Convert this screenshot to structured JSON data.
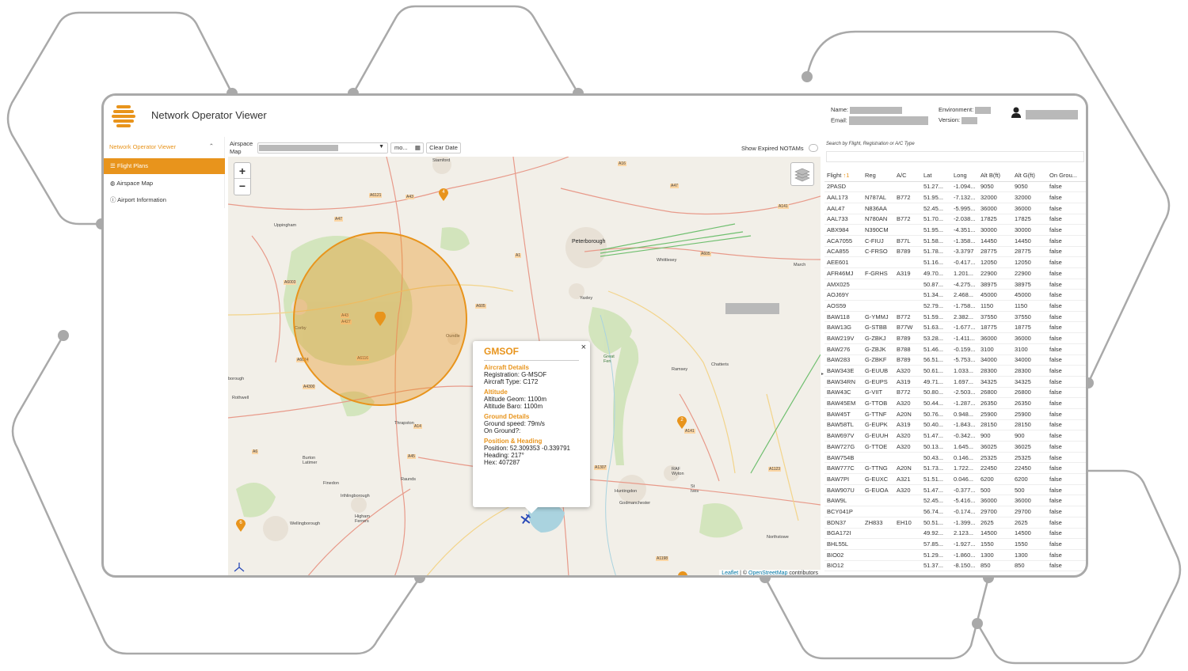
{
  "app": {
    "title": "Network Operator Viewer"
  },
  "header": {
    "name_label": "Name:",
    "email_label": "Email:",
    "environment_label": "Environment:",
    "version_label": "Version:"
  },
  "sidebar": {
    "section": "Network Operator Viewer",
    "items": [
      {
        "label": "Flight Plans",
        "icon": "list-icon"
      },
      {
        "label": "Airspace Map",
        "icon": "globe-icon"
      },
      {
        "label": "Airport Information",
        "icon": "info-icon"
      }
    ]
  },
  "toolbar": {
    "airspace_label_1": "Airspace",
    "airspace_label_2": "Map",
    "date_value": "mo...",
    "clear_date": "Clear Date",
    "show_expired": "Show Expired NOTAMs"
  },
  "map": {
    "zoom_in": "+",
    "zoom_out": "−",
    "attribution_leaflet": "Leaflet",
    "attribution_sep": "| ©",
    "attribution_osm": "OpenStreetMap",
    "attribution_tail": "contributors",
    "places": [
      "Stamford",
      "Uppingham",
      "Peterborough",
      "Whittlesey",
      "March",
      "Yaxley",
      "Corby",
      "Oundle",
      "Ramsey",
      "Chatteris",
      "Great Fen",
      "Thrapston",
      "Burton Latimer",
      "Raunds",
      "Finedon",
      "Irthlingborough",
      "Higham Ferrers",
      "Wellingborough",
      "Huntingdon",
      "Godmanchester",
      "St Ives",
      "RAF Wyton",
      "Northstowe",
      "Rothwell",
      "borough"
    ],
    "roads": [
      "A16",
      "A47",
      "A43",
      "A6121",
      "A47",
      "A141",
      "A1",
      "A605",
      "A6003",
      "A43",
      "A427",
      "A6116",
      "A6014",
      "A4300",
      "A605",
      "A14",
      "A45",
      "A1307",
      "A141",
      "A1123",
      "A1198",
      "A6"
    ],
    "markers": [
      "2",
      "2",
      "6",
      "4"
    ]
  },
  "popup": {
    "title": "GMSOF",
    "close": "×",
    "aircraft_header": "Aircraft Details",
    "registration": "Registration: G-MSOF",
    "aircraft_type": "Aircraft Type: C172",
    "altitude_header": "Altitude",
    "alt_geom": "Altitude Geom: 1100m",
    "alt_baro": "Altitude Baro: 1100m",
    "ground_header": "Ground Details",
    "ground_speed": "Ground speed: 79m/s",
    "on_ground": "On Ground?:",
    "position_header": "Position & Heading",
    "position": "Position: 52.309353 -0.339791",
    "heading": "Heading: 217°",
    "hex": "Hex: 407287"
  },
  "table": {
    "search_placeholder": "Search by Flight, Registration or A/C Type",
    "columns": [
      "Flight",
      "Reg",
      "A/C",
      "Lat",
      "Long",
      "Alt B(ft)",
      "Alt G(ft)",
      "On Grou..."
    ],
    "sort_indicator": "↑1",
    "rows": [
      [
        "2PASD",
        "",
        "",
        "51.27...",
        "-1.094...",
        "9050",
        "9050",
        "false"
      ],
      [
        "AAL173",
        "N787AL",
        "B772",
        "51.95...",
        "-7.132...",
        "32000",
        "32000",
        "false"
      ],
      [
        "AAL47",
        "N836AA",
        "",
        "52.45...",
        "-5.995...",
        "36000",
        "36000",
        "false"
      ],
      [
        "AAL733",
        "N780AN",
        "B772",
        "51.70...",
        "-2.038...",
        "17825",
        "17825",
        "false"
      ],
      [
        "ABX984",
        "N390CM",
        "",
        "51.95...",
        "-4.351...",
        "30000",
        "30000",
        "false"
      ],
      [
        "ACA7055",
        "C-FIUJ",
        "B77L",
        "51.58...",
        "-1.358...",
        "14450",
        "14450",
        "false"
      ],
      [
        "ACA855",
        "C-FRSO",
        "B789",
        "51.78...",
        "-3.3797",
        "28775",
        "28775",
        "false"
      ],
      [
        "AEE601",
        "",
        "",
        "51.16...",
        "-0.417...",
        "12050",
        "12050",
        "false"
      ],
      [
        "AFR46MJ",
        "F-GRHS",
        "A319",
        "49.70...",
        "1.201...",
        "22900",
        "22900",
        "false"
      ],
      [
        "AMX025",
        "",
        "",
        "50.87...",
        "-4.275...",
        "38975",
        "38975",
        "false"
      ],
      [
        "AOJ69Y",
        "",
        "",
        "51.34...",
        "2.468...",
        "45000",
        "45000",
        "false"
      ],
      [
        "AOS59",
        "",
        "",
        "52.79...",
        "-1.758...",
        "1150",
        "1150",
        "false"
      ],
      [
        "BAW118",
        "G-YMMJ",
        "B772",
        "51.59...",
        "2.382...",
        "37550",
        "37550",
        "false"
      ],
      [
        "BAW13G",
        "G-STBB",
        "B77W",
        "51.63...",
        "-1.677...",
        "18775",
        "18775",
        "false"
      ],
      [
        "BAW219V",
        "G-ZBKJ",
        "B789",
        "53.28...",
        "-1.411...",
        "36000",
        "36000",
        "false"
      ],
      [
        "BAW276",
        "G-ZBJK",
        "B788",
        "51.46...",
        "-0.159...",
        "3100",
        "3100",
        "false"
      ],
      [
        "BAW283",
        "G-ZBKF",
        "B789",
        "56.51...",
        "-5.753...",
        "34000",
        "34000",
        "false"
      ],
      [
        "BAW343E",
        "G-EUUB",
        "A320",
        "50.61...",
        "1.033...",
        "28300",
        "28300",
        "false"
      ],
      [
        "BAW34RN",
        "G-EUPS",
        "A319",
        "49.71...",
        "1.697...",
        "34325",
        "34325",
        "false"
      ],
      [
        "BAW43C",
        "G-VIIT",
        "B772",
        "50.80...",
        "-2.503...",
        "26800",
        "26800",
        "false"
      ],
      [
        "BAW45EM",
        "G-TTOB",
        "A320",
        "50.44...",
        "-1.287...",
        "26350",
        "26350",
        "false"
      ],
      [
        "BAW45T",
        "G-TTNF",
        "A20N",
        "50.76...",
        "0.948...",
        "25900",
        "25900",
        "false"
      ],
      [
        "BAW58TL",
        "G-EUPK",
        "A319",
        "50.40...",
        "-1.843...",
        "28150",
        "28150",
        "false"
      ],
      [
        "BAW697V",
        "G-EUUH",
        "A320",
        "51.47...",
        "-0.342...",
        "900",
        "900",
        "false"
      ],
      [
        "BAW727G",
        "G-TTOE",
        "A320",
        "50.13...",
        "1.645...",
        "36025",
        "36025",
        "false"
      ],
      [
        "BAW754B",
        "",
        "",
        "50.43...",
        "0.146...",
        "25325",
        "25325",
        "false"
      ],
      [
        "BAW777C",
        "G-TTNG",
        "A20N",
        "51.73...",
        "1.722...",
        "22450",
        "22450",
        "false"
      ],
      [
        "BAW7PI",
        "G-EUXC",
        "A321",
        "51.51...",
        "0.046...",
        "6200",
        "6200",
        "false"
      ],
      [
        "BAW907U",
        "G-EUOA",
        "A320",
        "51.47...",
        "-0.377...",
        "500",
        "500",
        "false"
      ],
      [
        "BAW9L",
        "",
        "",
        "52.45...",
        "-5.416...",
        "36000",
        "36000",
        "false"
      ],
      [
        "BCY041P",
        "",
        "",
        "56.74...",
        "-0.174...",
        "29700",
        "29700",
        "false"
      ],
      [
        "BDN37",
        "ZH833",
        "EH10",
        "50.51...",
        "-1.399...",
        "2625",
        "2625",
        "false"
      ],
      [
        "BGA172I",
        "",
        "",
        "49.92...",
        "2.123...",
        "14500",
        "14500",
        "false"
      ],
      [
        "BHL55L",
        "",
        "",
        "57.85...",
        "-1.927...",
        "1550",
        "1550",
        "false"
      ],
      [
        "BIO02",
        "",
        "",
        "51.29...",
        "-1.860...",
        "1300",
        "1300",
        "false"
      ],
      [
        "BIO12",
        "",
        "",
        "51.37...",
        "-8.150...",
        "850",
        "850",
        "false"
      ]
    ]
  },
  "colors": {
    "accent": "#e8941c",
    "frame": "#a9a9a9"
  }
}
